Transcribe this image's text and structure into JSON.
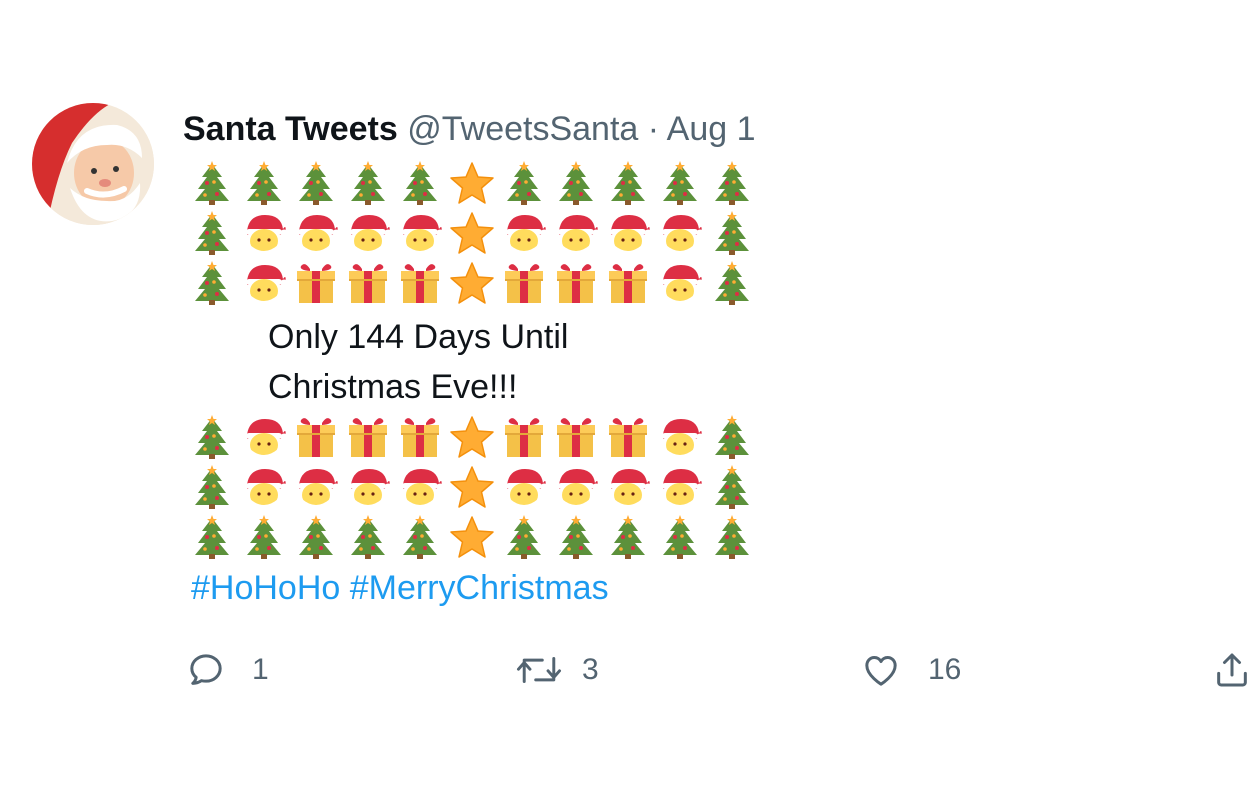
{
  "tweet": {
    "display_name": "Santa Tweets",
    "handle": "@TweetsSanta",
    "separator": "·",
    "date": "Aug 1",
    "emoji_top": [
      [
        "tree",
        "tree",
        "tree",
        "tree",
        "tree",
        "star",
        "tree",
        "tree",
        "tree",
        "tree",
        "tree"
      ],
      [
        "tree",
        "santa",
        "santa",
        "santa",
        "santa",
        "star",
        "santa",
        "santa",
        "santa",
        "santa",
        "tree"
      ],
      [
        "tree",
        "santa",
        "gift",
        "gift",
        "gift",
        "star",
        "gift",
        "gift",
        "gift",
        "santa",
        "tree"
      ]
    ],
    "message_lines": [
      "Only 144 Days Until",
      "Christmas Eve!!!"
    ],
    "emoji_bottom": [
      [
        "tree",
        "santa",
        "gift",
        "gift",
        "gift",
        "star",
        "gift",
        "gift",
        "gift",
        "santa",
        "tree"
      ],
      [
        "tree",
        "santa",
        "santa",
        "santa",
        "santa",
        "star",
        "santa",
        "santa",
        "santa",
        "santa",
        "tree"
      ],
      [
        "tree",
        "tree",
        "tree",
        "tree",
        "tree",
        "star",
        "tree",
        "tree",
        "tree",
        "tree",
        "tree"
      ]
    ],
    "hashtags": [
      "#HoHoHo",
      "#MerryChristmas"
    ]
  },
  "actions": {
    "reply": {
      "icon": "reply-icon",
      "count": "1"
    },
    "retweet": {
      "icon": "retweet-icon",
      "count": "3"
    },
    "like": {
      "icon": "heart-icon",
      "count": "16"
    },
    "share": {
      "icon": "share-icon"
    }
  },
  "colors": {
    "text": "#0f1419",
    "muted": "#536471",
    "link": "#1d9bf0",
    "tree_green": "#5c913b",
    "star_gold": "#ffac33",
    "santa_red": "#dd2e44",
    "gift_yellow": "#fdcb58"
  }
}
